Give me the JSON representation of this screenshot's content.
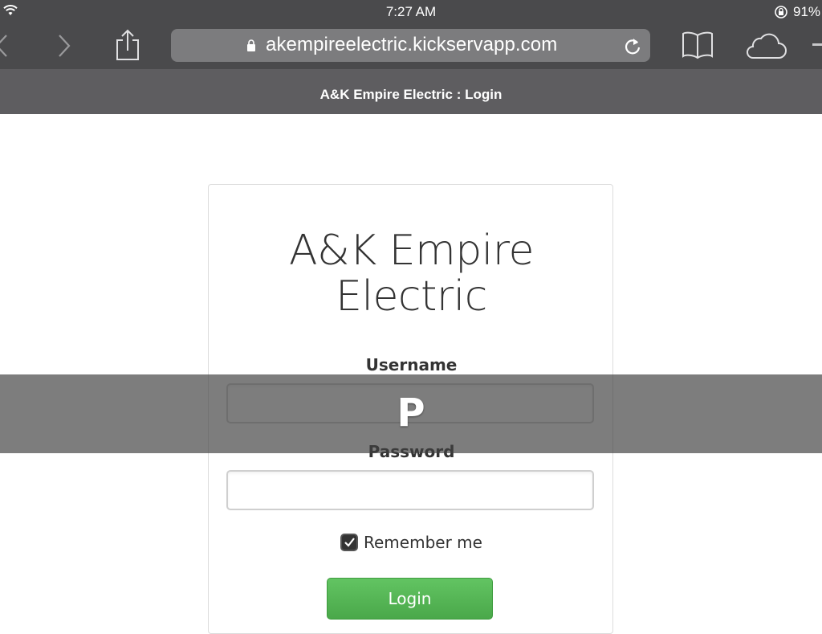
{
  "status_bar": {
    "time": "7:27 AM",
    "battery": "91%"
  },
  "browser": {
    "url": "akempireelectric.kickservapp.com",
    "page_title": "A&K Empire Electric : Login"
  },
  "login_form": {
    "heading": "A&K Empire Electric",
    "username_label": "Username",
    "username_value": "",
    "password_label": "Password",
    "password_value": "",
    "remember_label": "Remember me",
    "remember_checked": true,
    "login_button": "Login"
  },
  "key_preview": {
    "character": "P"
  },
  "colors": {
    "chrome_dark": "#4a4a4c",
    "title_bar": "#5e5d60",
    "login_green": "#5cb85c"
  },
  "icons": [
    "wifi-icon",
    "rotation-lock-icon",
    "back-icon",
    "forward-icon",
    "share-icon",
    "padlock-icon",
    "reload-icon",
    "bookmarks-icon",
    "icloud-tabs-icon",
    "new-tab-icon",
    "checkmark-icon"
  ]
}
